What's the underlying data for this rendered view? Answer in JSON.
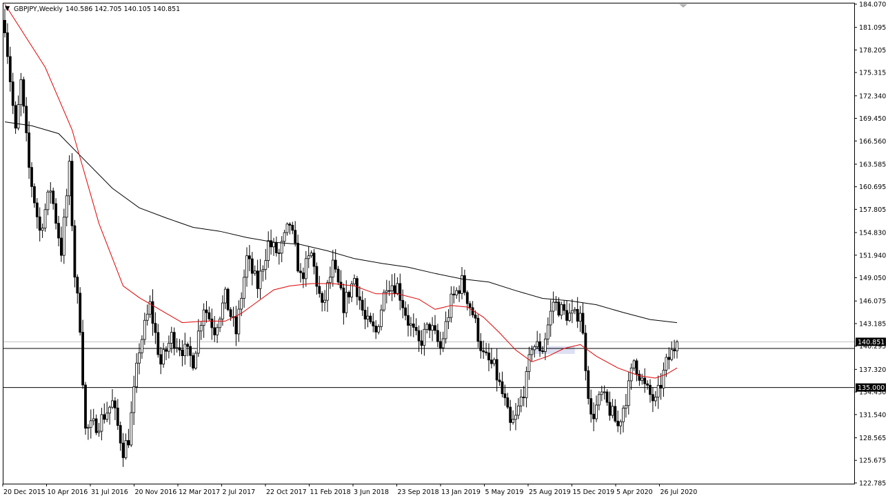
{
  "header": {
    "arrow": "▼",
    "symbol": "GBPJPY,Weekly",
    "ohlc": "140.586 142.705 140.105 140.851"
  },
  "colors": {
    "background": "#ffffff",
    "candle_up": "#ffffff",
    "candle_down": "#000000",
    "candle_outline": "#000000",
    "ma_fast": "#e00000",
    "ma_slow": "#000000",
    "zone": "#dde0f2",
    "hline": "#000000",
    "price_line": "#c0c0c0"
  },
  "chart_data": {
    "type": "candlestick",
    "symbol": "GBPJPY",
    "timeframe": "Weekly",
    "ylim": [
      122.78,
      184.07
    ],
    "y_ticks": [
      "184.070",
      "181.095",
      "178.205",
      "175.315",
      "172.340",
      "169.450",
      "166.560",
      "163.585",
      "160.695",
      "157.805",
      "154.830",
      "151.940",
      "149.050",
      "146.075",
      "143.185",
      "140.295",
      "137.320",
      "134.430",
      "131.540",
      "128.565",
      "125.675",
      "122.785"
    ],
    "x_ticks": [
      "20 Dec 2015",
      "10 Apr 2016",
      "31 Jul 2016",
      "20 Nov 2016",
      "12 Mar 2017",
      "2 Jul 2017",
      "22 Oct 2017",
      "11 Feb 2018",
      "3 Jun 2018",
      "23 Sep 2018",
      "13 Jan 2019",
      "5 May 2019",
      "25 Aug 2019",
      "15 Dec 2019",
      "5 Apr 2020",
      "26 Jul 2020"
    ],
    "price_marks": [
      {
        "label": "140.851",
        "value": 140.851,
        "style": "current"
      },
      {
        "label": "135.000",
        "value": 135.0,
        "style": "level"
      }
    ],
    "levels": [
      140.0,
      135.0
    ],
    "zone": {
      "from_index": 196,
      "to_index": 212,
      "low": 139.3,
      "high": 140.3
    },
    "anchors": [
      [
        0,
        181.5
      ],
      [
        4,
        167.5
      ],
      [
        6,
        174
      ],
      [
        9,
        163
      ],
      [
        13,
        155
      ],
      [
        17,
        160.5
      ],
      [
        21,
        152.5
      ],
      [
        24,
        163
      ],
      [
        26,
        149.5
      ],
      [
        28,
        143
      ],
      [
        30,
        129.5
      ],
      [
        35,
        130.5
      ],
      [
        40,
        133
      ],
      [
        44,
        127
      ],
      [
        46,
        128.5
      ],
      [
        50,
        140
      ],
      [
        54,
        145.5
      ],
      [
        58,
        138
      ],
      [
        62,
        141.5
      ],
      [
        66,
        140
      ],
      [
        70,
        138.5
      ],
      [
        74,
        145.5
      ],
      [
        78,
        142.5
      ],
      [
        82,
        146.5
      ],
      [
        86,
        142
      ],
      [
        90,
        151.5
      ],
      [
        94,
        148
      ],
      [
        98,
        153.5
      ],
      [
        102,
        152
      ],
      [
        106,
        156
      ],
      [
        110,
        149
      ],
      [
        114,
        152
      ],
      [
        118,
        145
      ],
      [
        122,
        150.5
      ],
      [
        126,
        145.5
      ],
      [
        130,
        149
      ],
      [
        134,
        143.5
      ],
      [
        138,
        142
      ],
      [
        142,
        148.5
      ],
      [
        146,
        148
      ],
      [
        150,
        143.5
      ],
      [
        154,
        140.5
      ],
      [
        158,
        143
      ],
      [
        162,
        140
      ],
      [
        166,
        146
      ],
      [
        170,
        148.5
      ],
      [
        174,
        144.5
      ],
      [
        178,
        139
      ],
      [
        182,
        137.5
      ],
      [
        186,
        133
      ],
      [
        188,
        130
      ],
      [
        190,
        131
      ],
      [
        194,
        136
      ],
      [
        196,
        140.5
      ],
      [
        200,
        140
      ],
      [
        204,
        146
      ],
      [
        208,
        144.5
      ],
      [
        212,
        144
      ],
      [
        214,
        145
      ],
      [
        216,
        138
      ],
      [
        218,
        131
      ],
      [
        222,
        134
      ],
      [
        226,
        131.5
      ],
      [
        228,
        130
      ],
      [
        232,
        135
      ],
      [
        234,
        138.5
      ],
      [
        238,
        135
      ],
      [
        242,
        133
      ],
      [
        246,
        138
      ],
      [
        250,
        140.851
      ]
    ],
    "ma_fast": [
      [
        0,
        184.07
      ],
      [
        15,
        176
      ],
      [
        25,
        168
      ],
      [
        35,
        156
      ],
      [
        44,
        148
      ],
      [
        50,
        146.5
      ],
      [
        55,
        145.5
      ],
      [
        60,
        144.5
      ],
      [
        66,
        143.3
      ],
      [
        74,
        143.5
      ],
      [
        82,
        143.5
      ],
      [
        88,
        144.5
      ],
      [
        94,
        146
      ],
      [
        100,
        147.5
      ],
      [
        106,
        148
      ],
      [
        114,
        148.3
      ],
      [
        122,
        148.3
      ],
      [
        130,
        148
      ],
      [
        138,
        147
      ],
      [
        146,
        147
      ],
      [
        154,
        146.3
      ],
      [
        160,
        145
      ],
      [
        166,
        145.5
      ],
      [
        172,
        145.3
      ],
      [
        178,
        144
      ],
      [
        184,
        142
      ],
      [
        190,
        139.8
      ],
      [
        196,
        138.3
      ],
      [
        202,
        139
      ],
      [
        208,
        140
      ],
      [
        214,
        140.5
      ],
      [
        220,
        139
      ],
      [
        228,
        137.5
      ],
      [
        236,
        136.5
      ],
      [
        242,
        136.2
      ],
      [
        246,
        136.7
      ],
      [
        250,
        137.5
      ]
    ],
    "ma_slow": [
      [
        0,
        169
      ],
      [
        10,
        168.5
      ],
      [
        20,
        167.5
      ],
      [
        30,
        164
      ],
      [
        40,
        160.5
      ],
      [
        50,
        158
      ],
      [
        60,
        156.7
      ],
      [
        70,
        155.5
      ],
      [
        80,
        155
      ],
      [
        90,
        154.2
      ],
      [
        100,
        153.6
      ],
      [
        110,
        153.3
      ],
      [
        120,
        152.5
      ],
      [
        130,
        151.5
      ],
      [
        140,
        150.9
      ],
      [
        150,
        150.4
      ],
      [
        160,
        149.6
      ],
      [
        170,
        148.9
      ],
      [
        180,
        148.5
      ],
      [
        190,
        147.4
      ],
      [
        200,
        146.4
      ],
      [
        210,
        146.1
      ],
      [
        220,
        145.6
      ],
      [
        230,
        144.6
      ],
      [
        240,
        143.7
      ],
      [
        250,
        143.3
      ]
    ]
  }
}
